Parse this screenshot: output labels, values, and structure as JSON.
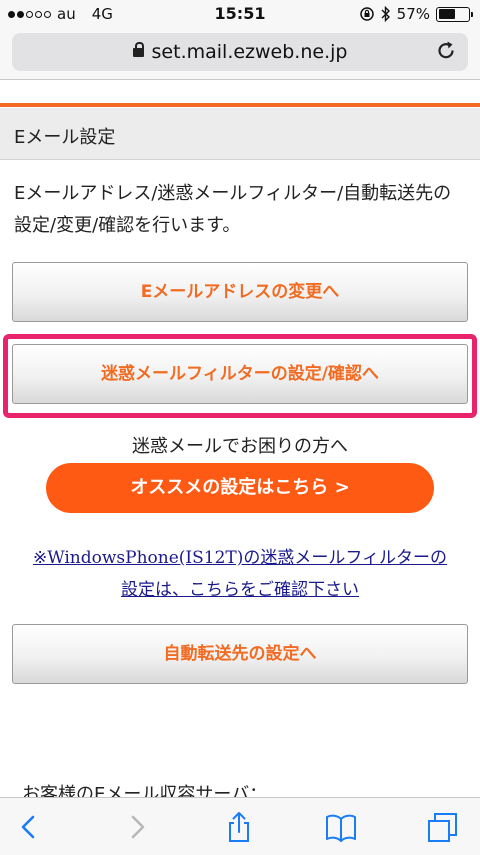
{
  "status_bar": {
    "carrier": "au",
    "network": "4G",
    "time": "15:51",
    "battery_percent": "57%",
    "battery_level": 0.57
  },
  "browser": {
    "url": "set.mail.ezweb.ne.jp"
  },
  "page": {
    "section_title": "Eメール設定",
    "intro": "Eメールアドレス/迷惑メールフィルター/自動転送先の設定/変更/確認を行います。",
    "buttons": {
      "change_address": "Eメールアドレスの変更へ",
      "spam_filter": "迷惑メールフィルターの設定/確認へ",
      "forwarding": "自動転送先の設定へ"
    },
    "spam_trouble_text": "迷惑メールでお困りの方へ",
    "recommend_button": "オススメの設定はこちら >",
    "windows_phone_link_line1": "※WindowsPhone(IS12T)の迷惑メールフィルターの",
    "windows_phone_link_line2": "設定は、こちらをご確認下さい",
    "bottom_partial": "お客様のEメール収容サーバ："
  },
  "colors": {
    "accent_orange": "#f26b22",
    "recommend_orange": "#ff5a14",
    "highlight_pink": "#e8236c",
    "link_blue": "#1a1a8c"
  }
}
